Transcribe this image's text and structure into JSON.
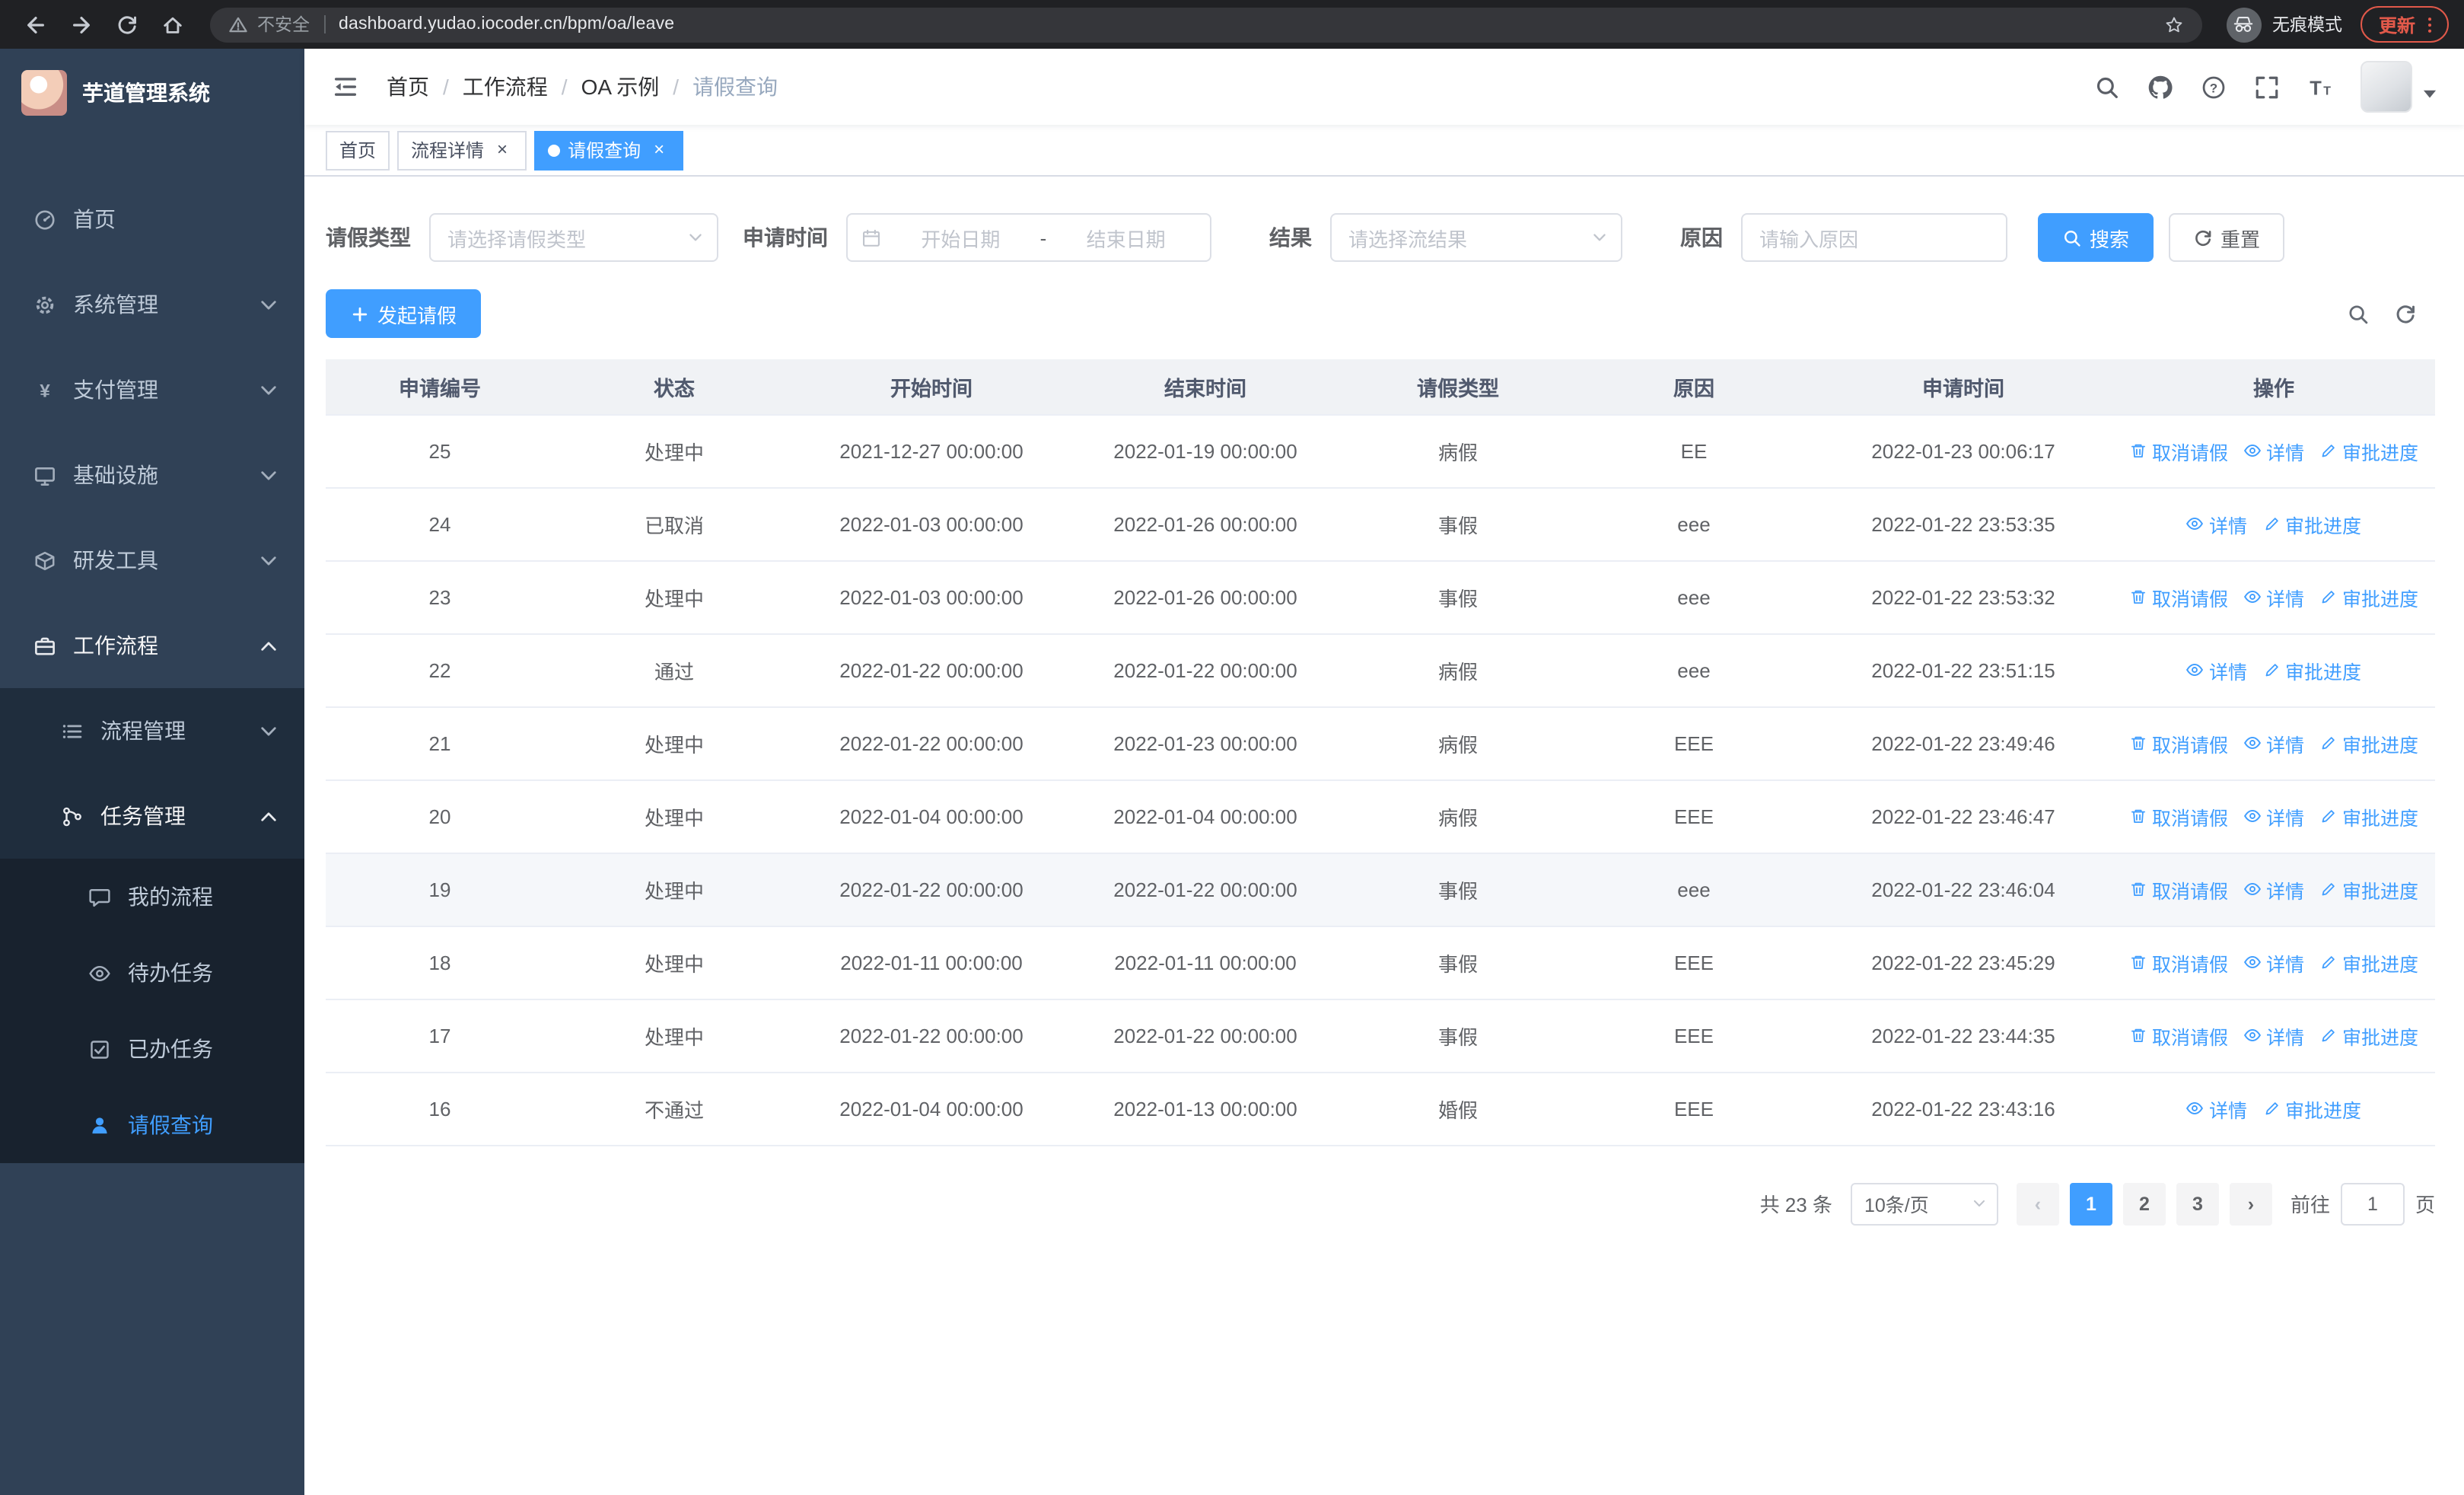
{
  "browser": {
    "security_label": "不安全",
    "url": "dashboard.yudao.iocoder.cn/bpm/oa/leave",
    "incognito_label": "无痕模式",
    "update_label": "更新"
  },
  "sidebar": {
    "logo_title": "芋道管理系统",
    "items": [
      {
        "id": "home",
        "label": "首页",
        "icon": "dashboard-icon",
        "level": 1
      },
      {
        "id": "system",
        "label": "系统管理",
        "icon": "gear-icon",
        "level": 1,
        "chevron": "down"
      },
      {
        "id": "payment",
        "label": "支付管理",
        "icon": "yen-icon",
        "level": 1,
        "chevron": "down"
      },
      {
        "id": "infra",
        "label": "基础设施",
        "icon": "monitor-icon",
        "level": 1,
        "chevron": "down"
      },
      {
        "id": "devtools",
        "label": "研发工具",
        "icon": "box-icon",
        "level": 1,
        "chevron": "down"
      },
      {
        "id": "workflow",
        "label": "工作流程",
        "icon": "briefcase-icon",
        "level": 1,
        "chevron": "up",
        "open": true
      },
      {
        "id": "process-mgmt",
        "label": "流程管理",
        "icon": "list-icon",
        "level": 2,
        "chevron": "down"
      },
      {
        "id": "task-mgmt",
        "label": "任务管理",
        "icon": "branch-icon",
        "level": 2,
        "chevron": "up",
        "open": true
      },
      {
        "id": "my-process",
        "label": "我的流程",
        "icon": "chat-icon",
        "level": 3
      },
      {
        "id": "todo-task",
        "label": "待办任务",
        "icon": "eye-icon",
        "level": 3
      },
      {
        "id": "done-task",
        "label": "已办任务",
        "icon": "check-icon",
        "level": 3
      },
      {
        "id": "leave-query",
        "label": "请假查询",
        "icon": "user-icon",
        "level": 3,
        "active": true
      }
    ]
  },
  "navbar": {
    "breadcrumb_separator": "/",
    "breadcrumb": [
      {
        "label": "首页"
      },
      {
        "label": "工作流程"
      },
      {
        "label": "OA 示例"
      },
      {
        "label": "请假查询",
        "current": true
      }
    ]
  },
  "tabs": [
    {
      "label": "首页",
      "closable": false,
      "active": false
    },
    {
      "label": "流程详情",
      "closable": true,
      "active": false
    },
    {
      "label": "请假查询",
      "closable": true,
      "active": true
    }
  ],
  "filters": {
    "leave_type": {
      "label": "请假类型",
      "placeholder": "请选择请假类型"
    },
    "apply_time": {
      "label": "申请时间",
      "start_placeholder": "开始日期",
      "separator": "-",
      "end_placeholder": "结束日期"
    },
    "result": {
      "label": "结果",
      "placeholder": "请选择流结果"
    },
    "reason": {
      "label": "原因",
      "placeholder": "请输入原因"
    },
    "search_label": "搜索",
    "reset_label": "重置"
  },
  "toolbar": {
    "create_label": "发起请假"
  },
  "table": {
    "columns": [
      "申请编号",
      "状态",
      "开始时间",
      "结束时间",
      "请假类型",
      "原因",
      "申请时间",
      "操作"
    ],
    "action_labels": {
      "cancel": "取消请假",
      "detail": "详情",
      "progress": "审批进度"
    },
    "rows": [
      {
        "id": "25",
        "status": "处理中",
        "start": "2021-12-27 00:00:00",
        "end": "2022-01-19 00:00:00",
        "type": "病假",
        "reason": "EE",
        "apply_time": "2022-01-23 00:06:17",
        "actions": [
          "cancel",
          "detail",
          "progress"
        ]
      },
      {
        "id": "24",
        "status": "已取消",
        "start": "2022-01-03 00:00:00",
        "end": "2022-01-26 00:00:00",
        "type": "事假",
        "reason": "eee",
        "apply_time": "2022-01-22 23:53:35",
        "actions": [
          "detail",
          "progress"
        ]
      },
      {
        "id": "23",
        "status": "处理中",
        "start": "2022-01-03 00:00:00",
        "end": "2022-01-26 00:00:00",
        "type": "事假",
        "reason": "eee",
        "apply_time": "2022-01-22 23:53:32",
        "actions": [
          "cancel",
          "detail",
          "progress"
        ]
      },
      {
        "id": "22",
        "status": "通过",
        "start": "2022-01-22 00:00:00",
        "end": "2022-01-22 00:00:00",
        "type": "病假",
        "reason": "eee",
        "apply_time": "2022-01-22 23:51:15",
        "actions": [
          "detail",
          "progress"
        ]
      },
      {
        "id": "21",
        "status": "处理中",
        "start": "2022-01-22 00:00:00",
        "end": "2022-01-23 00:00:00",
        "type": "病假",
        "reason": "EEE",
        "apply_time": "2022-01-22 23:49:46",
        "actions": [
          "cancel",
          "detail",
          "progress"
        ]
      },
      {
        "id": "20",
        "status": "处理中",
        "start": "2022-01-04 00:00:00",
        "end": "2022-01-04 00:00:00",
        "type": "病假",
        "reason": "EEE",
        "apply_time": "2022-01-22 23:46:47",
        "actions": [
          "cancel",
          "detail",
          "progress"
        ]
      },
      {
        "id": "19",
        "status": "处理中",
        "start": "2022-01-22 00:00:00",
        "end": "2022-01-22 00:00:00",
        "type": "事假",
        "reason": "eee",
        "apply_time": "2022-01-22 23:46:04",
        "actions": [
          "cancel",
          "detail",
          "progress"
        ],
        "hovered": true
      },
      {
        "id": "18",
        "status": "处理中",
        "start": "2022-01-11 00:00:00",
        "end": "2022-01-11 00:00:00",
        "type": "事假",
        "reason": "EEE",
        "apply_time": "2022-01-22 23:45:29",
        "actions": [
          "cancel",
          "detail",
          "progress"
        ]
      },
      {
        "id": "17",
        "status": "处理中",
        "start": "2022-01-22 00:00:00",
        "end": "2022-01-22 00:00:00",
        "type": "事假",
        "reason": "EEE",
        "apply_time": "2022-01-22 23:44:35",
        "actions": [
          "cancel",
          "detail",
          "progress"
        ]
      },
      {
        "id": "16",
        "status": "不通过",
        "start": "2022-01-04 00:00:00",
        "end": "2022-01-13 00:00:00",
        "type": "婚假",
        "reason": "EEE",
        "apply_time": "2022-01-22 23:43:16",
        "actions": [
          "detail",
          "progress"
        ]
      }
    ]
  },
  "pagination": {
    "total": "共 23 条",
    "page_size": "10条/页",
    "prev": "‹",
    "next": "›",
    "pages": [
      "1",
      "2",
      "3"
    ],
    "active_page": "1",
    "goto_label": "前往",
    "goto_value": "1",
    "unit_label": "页"
  },
  "colors": {
    "primary": "#409eff",
    "sidebar_bg": "#304156"
  }
}
